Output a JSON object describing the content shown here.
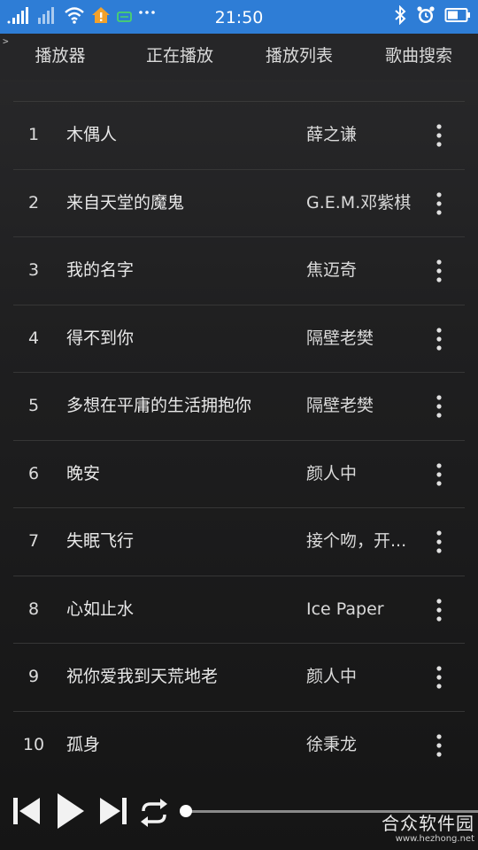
{
  "status_bar": {
    "time": "21:50",
    "bg_color": "#2e7dd6",
    "left_icons": [
      "signal-icon",
      "signal-icon",
      "wifi-icon",
      "home-alert-icon",
      "message-icon",
      "more-dots-icon"
    ],
    "right_icons": [
      "bluetooth-icon",
      "alarm-icon",
      "battery-icon"
    ]
  },
  "top_nav": {
    "stray_glyph": ">",
    "tabs": [
      {
        "label": "播放器"
      },
      {
        "label": "正在播放"
      },
      {
        "label": "播放列表"
      },
      {
        "label": "歌曲搜索"
      }
    ]
  },
  "songs": [
    {
      "num": "1",
      "title": "木偶人",
      "artist": "薛之谦"
    },
    {
      "num": "2",
      "title": "来自天堂的魔鬼",
      "artist": "G.E.M.邓紫棋"
    },
    {
      "num": "3",
      "title": "我的名字",
      "artist": "焦迈奇"
    },
    {
      "num": "4",
      "title": "得不到你",
      "artist": "隔壁老樊"
    },
    {
      "num": "5",
      "title": "多想在平庸的生活拥抱你",
      "artist": "隔壁老樊"
    },
    {
      "num": "6",
      "title": "晚安",
      "artist": "颜人中"
    },
    {
      "num": "7",
      "title": "失眠飞行",
      "artist": "接个吻，开..."
    },
    {
      "num": "8",
      "title": "心如止水",
      "artist": "Ice Paper"
    },
    {
      "num": "9",
      "title": "祝你爱我到天荒地老",
      "artist": "颜人中"
    },
    {
      "num": "10",
      "title": "孤身",
      "artist": "徐秉龙"
    }
  ],
  "player": {
    "controls": [
      "previous-icon",
      "play-icon",
      "next-icon",
      "repeat-icon"
    ],
    "progress": 0
  },
  "watermark": {
    "main": "合众软件园",
    "sub": "www.hezhong.net"
  }
}
